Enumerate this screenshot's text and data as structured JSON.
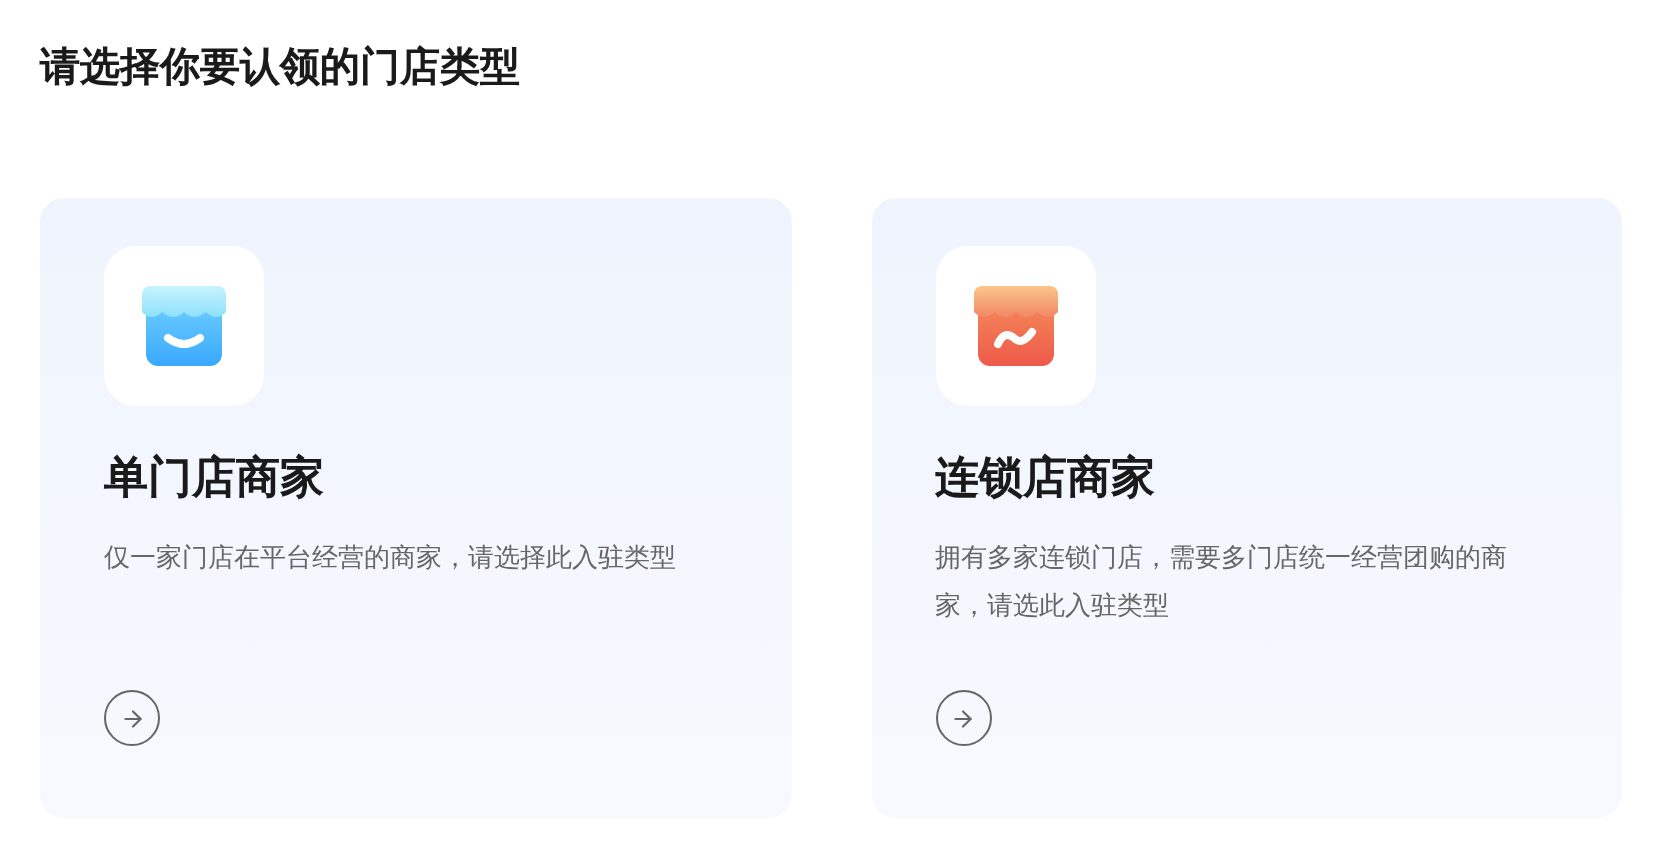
{
  "title": "请选择你要认领的门店类型",
  "cards": [
    {
      "kind": "single",
      "name": "单门店商家",
      "description": "仅一家门店在平台经营的商家，请选择此入驻类型"
    },
    {
      "kind": "chain",
      "name": "连锁店商家",
      "description": "拥有多家连锁门店，需要多门店统一经营团购的商家，请选此入驻类型"
    }
  ]
}
